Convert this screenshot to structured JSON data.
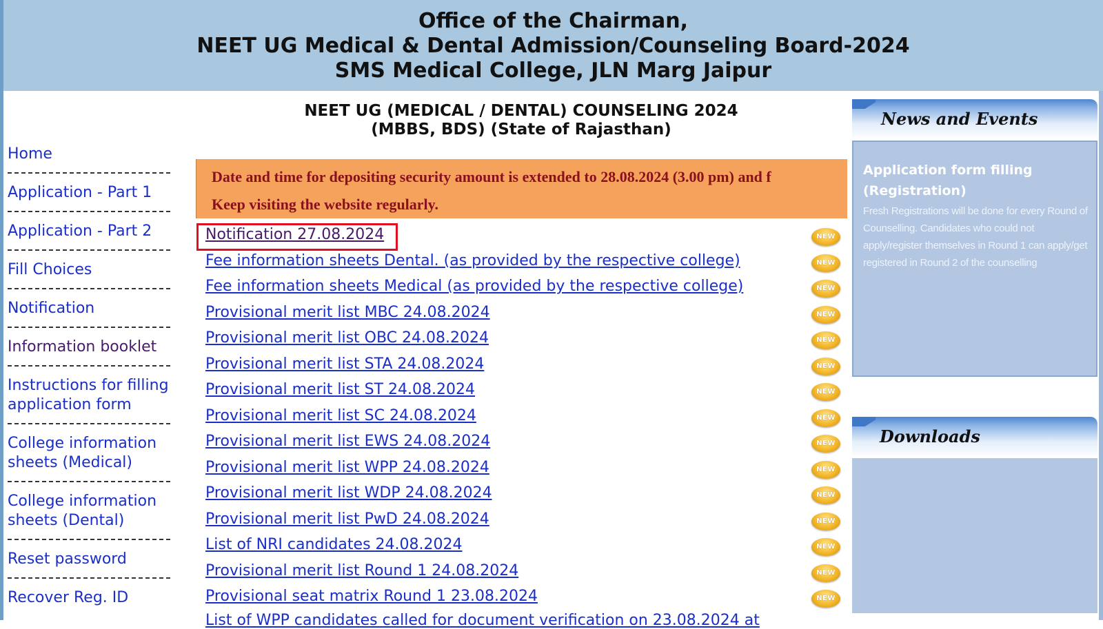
{
  "header": {
    "line1": "Office of the Chairman,",
    "line2": "NEET UG Medical & Dental Admission/Counseling Board-2024",
    "line3": "SMS Medical College, JLN Marg Jaipur"
  },
  "main": {
    "title_line1": "NEET UG (MEDICAL / DENTAL) COUNSELING 2024",
    "title_line2": "(MBBS, BDS) (State of Rajasthan)",
    "notice_line1": "Date and time for depositing security amount is extended to 28.08.2024 (3.00 pm) and f",
    "notice_line2": "Keep visiting the website regularly.",
    "new_badge": "NEW",
    "links": [
      "Notification 27.08.2024",
      "Fee information sheets Dental. (as provided by the respective college)",
      "Fee information sheets Medical (as provided by the respective college)",
      "Provisional merit list MBC 24.08.2024",
      "Provisional merit list OBC 24.08.2024",
      "Provisional merit list STA 24.08.2024",
      "Provisional merit list ST 24.08.2024",
      "Provisional merit list SC 24.08.2024",
      "Provisional merit list EWS 24.08.2024",
      "Provisional merit list WPP 24.08.2024",
      "Provisional merit list WDP 24.08.2024",
      "Provisional merit list PwD 24.08.2024",
      "List of NRI candidates 24.08.2024",
      "Provisional merit list Round 1 24.08.2024",
      "Provisional seat matrix Round 1 23.08.2024"
    ],
    "cutoff_link": "List of WPP candidates called for document verification on 23.08.2024 at"
  },
  "sidebar": {
    "items": [
      "Home",
      "Application - Part 1",
      "Application - Part 2",
      "Fill Choices",
      "Notification",
      "Information booklet",
      "Instructions for filling application form",
      "College information sheets (Medical)",
      "College information sheets (Dental)",
      "Reset password",
      "Recover Reg. ID"
    ]
  },
  "news": {
    "heading": "News and Events",
    "item_title": "Application form filling (Registration)",
    "item_text": "Fresh Registrations will be done for every Round of Counselling. Candidates who could not apply/register themselves in Round 1 can apply/get registered in Round 2 of the counselling"
  },
  "downloads": {
    "heading": "Downloads"
  },
  "colors": {
    "header_bg": "#a9c8e0",
    "link": "#1a2fc8",
    "notice_bg": "#f5a35c",
    "notice_text": "#8a1020",
    "highlight_box": "#e01020"
  }
}
